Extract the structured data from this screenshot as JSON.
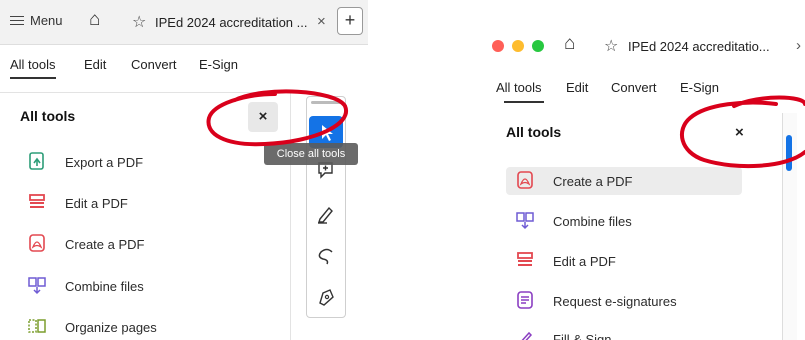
{
  "left": {
    "menu_label": "Menu",
    "tab": {
      "title": "IPEd 2024 accreditation ...",
      "close": "×",
      "new_tab": "+"
    },
    "nav": [
      "All tools",
      "Edit",
      "Convert",
      "E-Sign"
    ],
    "pane": {
      "title": "All tools",
      "close": "×"
    },
    "tools": [
      {
        "label": "Export a PDF",
        "icon": "export-pdf-icon"
      },
      {
        "label": "Edit a PDF",
        "icon": "edit-pdf-icon"
      },
      {
        "label": "Create a PDF",
        "icon": "create-pdf-icon"
      },
      {
        "label": "Combine files",
        "icon": "combine-files-icon"
      },
      {
        "label": "Organize pages",
        "icon": "organize-pages-icon"
      }
    ],
    "tooltip": "Close all tools"
  },
  "right": {
    "tab": {
      "title": "IPEd 2024 accreditatio...",
      "close": "›"
    },
    "nav": [
      "All tools",
      "Edit",
      "Convert",
      "E-Sign"
    ],
    "pane": {
      "title": "All tools",
      "close": "×"
    },
    "tools": [
      {
        "label": "Create a PDF",
        "icon": "create-pdf-icon",
        "highlighted": true
      },
      {
        "label": "Combine files",
        "icon": "combine-files-icon"
      },
      {
        "label": "Edit a PDF",
        "icon": "edit-pdf-icon"
      },
      {
        "label": "Request e-signatures",
        "icon": "request-esign-icon"
      },
      {
        "label": "Fill & Sign",
        "icon": "fill-sign-icon"
      }
    ]
  },
  "colors": {
    "accent": "#1473e6",
    "annotation": "#d9001b",
    "mac_close": "#ff5f57",
    "mac_min": "#febc2e",
    "mac_max": "#28c840"
  }
}
